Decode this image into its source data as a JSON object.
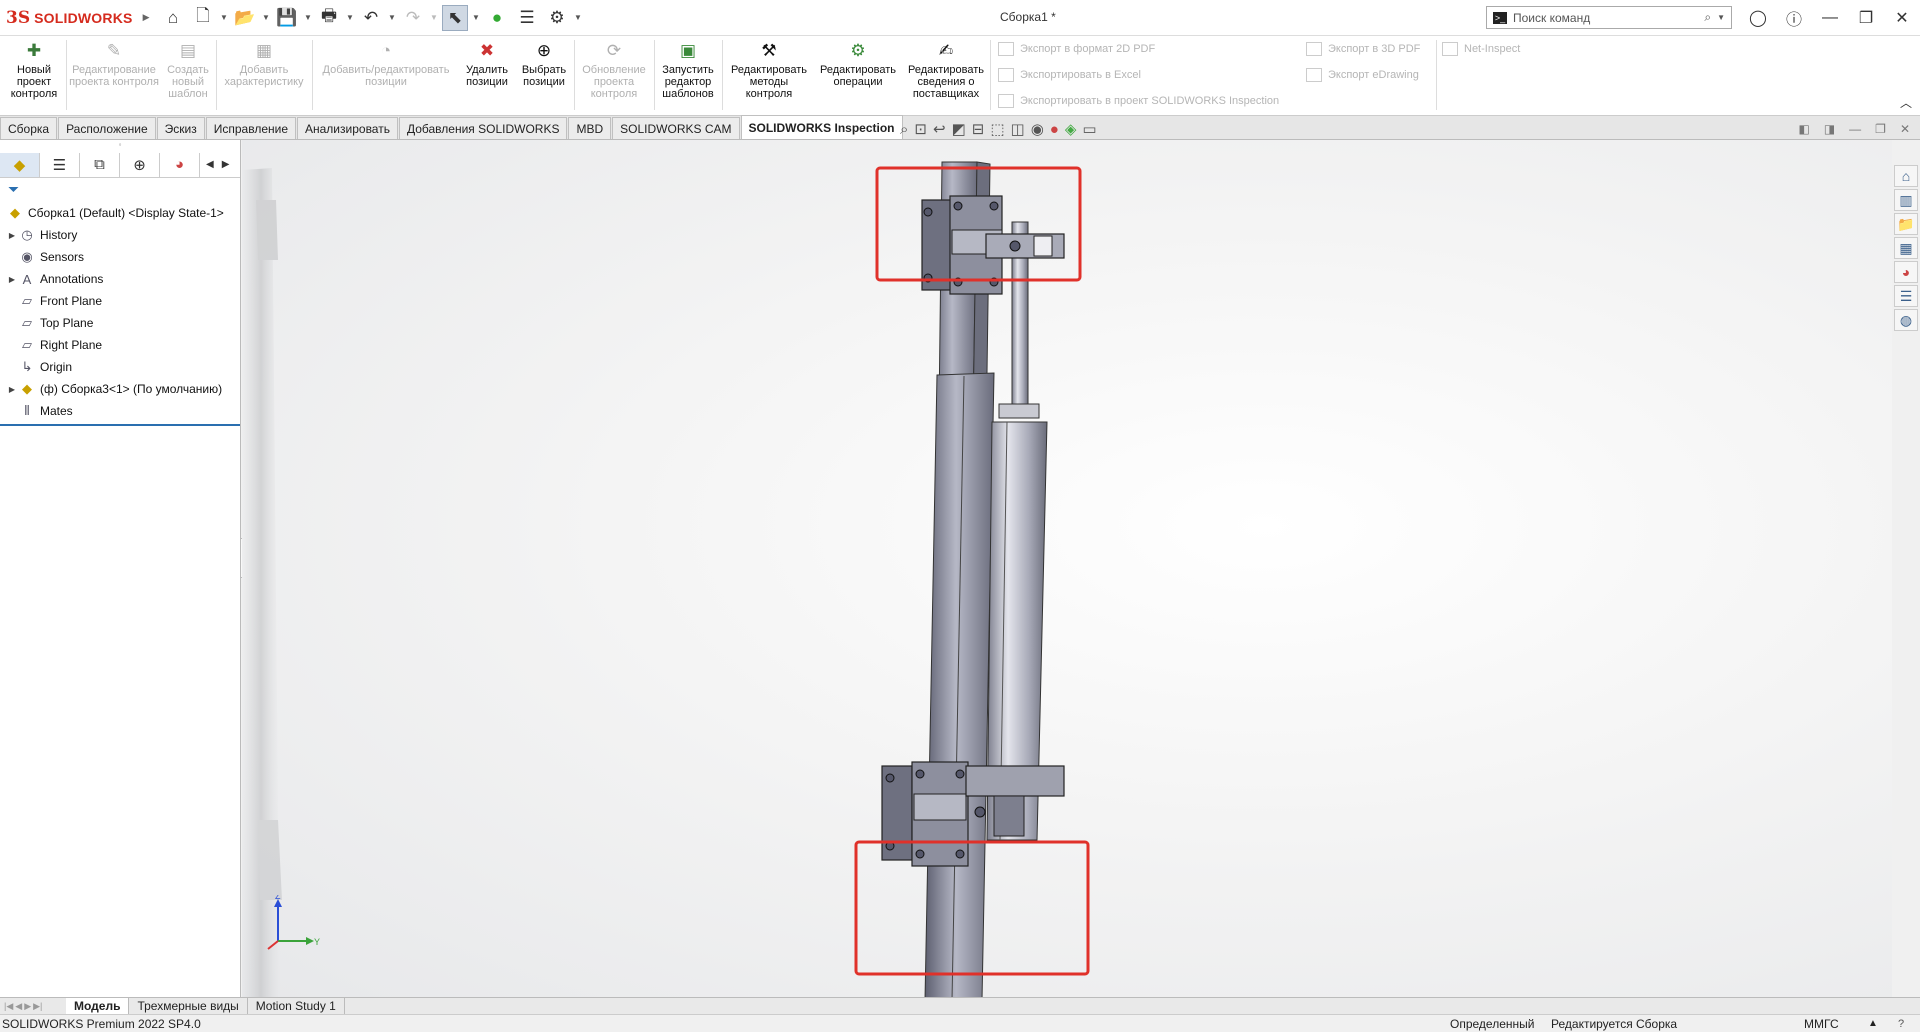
{
  "app": {
    "logo_mark": "3S",
    "logo_text": "SOLIDWORKS",
    "document_title": "Сборка1 *",
    "command_search_placeholder": "Поиск команд",
    "brand_color": "#d52b1e"
  },
  "quick_access": {
    "icons": [
      "home-icon",
      "new-document-icon",
      "open-icon",
      "save-icon",
      "print-icon",
      "undo-icon",
      "redo-icon",
      "select-arrow-icon",
      "rebuild-icon",
      "file-properties-icon",
      "options-gear-icon"
    ]
  },
  "ribbon": {
    "new_inspection_project": "Новый проект контроля",
    "edit_inspection_project": "Редактирование проекта контроля",
    "create_new_template": "Создать новый шаблон",
    "add_characteristic": "Добавить характеристику",
    "add_edit_balloons": "Добавить/редактировать позиции",
    "remove_balloons": "Удалить позиции",
    "select_balloons": "Выбрать позиции",
    "update_inspection_project": "Обновление проекта контроля",
    "launch_template_editor": "Запустить редактор шаблонов",
    "edit_inspection_methods": "Редактировать методы контроля",
    "edit_operations": "Редактировать операции",
    "edit_vendor_info": "Редактировать сведения о поставщиках",
    "export_2d_pdf": "Экспорт в формат 2D PDF",
    "export_excel": "Экспортировать в Excel",
    "export_inspection_project": "Экспортировать в проект SOLIDWORKS Inspection",
    "export_3d_pdf": "Экспорт в 3D PDF",
    "export_edrawing": "Экспорт eDrawing",
    "net_inspect": "Net-Inspect"
  },
  "tabs": [
    {
      "label": "Сборка",
      "active": false
    },
    {
      "label": "Расположение",
      "active": false
    },
    {
      "label": "Эскиз",
      "active": false
    },
    {
      "label": "Исправление",
      "active": false
    },
    {
      "label": "Анализировать",
      "active": false
    },
    {
      "label": "Добавления SOLIDWORKS",
      "active": false
    },
    {
      "label": "MBD",
      "active": false
    },
    {
      "label": "SOLIDWORKS CAM",
      "active": false
    },
    {
      "label": "SOLIDWORKS Inspection",
      "active": true
    }
  ],
  "feature_tree": {
    "root": "Сборка1 (Default) <Display State-1>",
    "items": [
      {
        "label": "History",
        "icon": "history-folder-icon",
        "expandable": true
      },
      {
        "label": "Sensors",
        "icon": "sensors-icon",
        "expandable": false
      },
      {
        "label": "Annotations",
        "icon": "annotations-icon",
        "expandable": true
      },
      {
        "label": "Front Plane",
        "icon": "plane-icon",
        "expandable": false
      },
      {
        "label": "Top Plane",
        "icon": "plane-icon",
        "expandable": false
      },
      {
        "label": "Right Plane",
        "icon": "plane-icon",
        "expandable": false
      },
      {
        "label": "Origin",
        "icon": "origin-icon",
        "expandable": false
      },
      {
        "label": "(ф) Сборка3<1> (По умолчанию)",
        "icon": "subassembly-icon",
        "expandable": true
      },
      {
        "label": "Mates",
        "icon": "mates-icon",
        "expandable": false
      }
    ]
  },
  "triad": {
    "z": "Z",
    "y": "Y"
  },
  "bottom_tabs": [
    {
      "label": "Модель",
      "active": true
    },
    {
      "label": "Трехмерные виды",
      "active": false
    },
    {
      "label": "Motion Study 1",
      "active": false
    }
  ],
  "status_bar": {
    "version": "SOLIDWORKS Premium 2022 SP4.0",
    "state": "Определенный",
    "editing": "Редактируется Сборка",
    "units": "ММГС",
    "units_arrow": "▲",
    "help_icon": "?"
  },
  "highlight_color": "#e0312a"
}
